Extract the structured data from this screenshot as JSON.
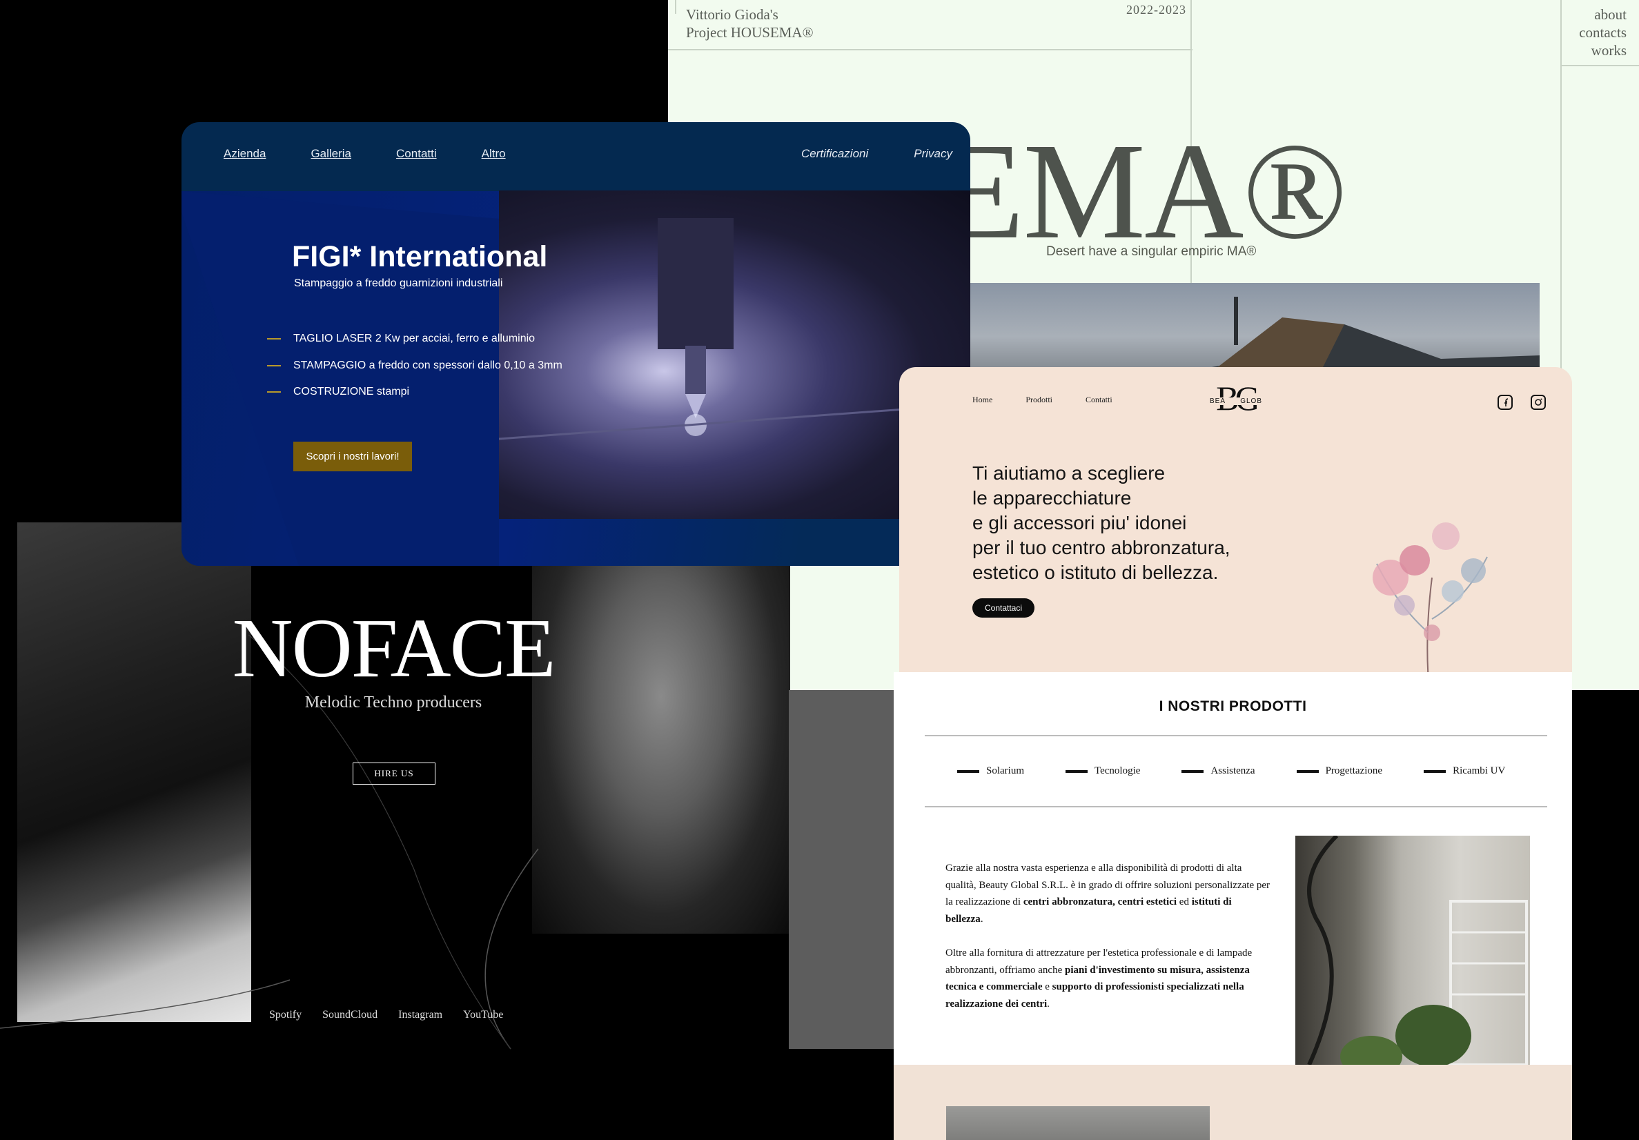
{
  "housema": {
    "author_line1": "Vittorio Gioda's",
    "author_line2": "Project HOUSEMA®",
    "year": "2022-2023",
    "nav": [
      "about",
      "contacts",
      "works"
    ],
    "big_title": "OUSEMA®",
    "tagline": "Desert have a singular empiric MA®"
  },
  "figi": {
    "nav_left": [
      "Azienda",
      "Galleria",
      "Contatti",
      "Altro"
    ],
    "nav_right": [
      "Certificazioni",
      "Privacy"
    ],
    "title": "FIGI* International",
    "subtitle": "Stampaggio a freddo guarnizioni industriali",
    "features": [
      "TAGLIO LASER 2 Kw per acciai, ferro e alluminio",
      "STAMPAGGIO a freddo con spessori dallo 0,10 a 3mm",
      "COSTRUZIONE stampi"
    ],
    "cta": "Scopri i nostri lavori!",
    "accent": "#7a5d0a"
  },
  "noface": {
    "title": "NOFACE",
    "subtitle": "Melodic Techno producers",
    "cta": "HIRE US",
    "links": [
      "Spotify",
      "SoundCloud",
      "Instagram",
      "YouTube"
    ]
  },
  "beauty": {
    "nav": [
      "Home",
      "Prodotti",
      "Contatti"
    ],
    "logo_mark": "BG",
    "logo_left": "BEA",
    "logo_right": "GLOB",
    "headline": [
      "Ti aiutiamo a scegliere",
      "le apparecchiature",
      "e gli accessori piu' idonei",
      "per il tuo centro abbronzatura,",
      "estetico o istituto di bellezza."
    ],
    "cta": "Contattaci",
    "section_title": "I NOSTRI PRODOTTI",
    "categories": [
      "Solarium",
      "Tecnologie",
      "Assistenza",
      "Progettazione",
      "Ricambi UV"
    ],
    "p1_parts": [
      "Grazie alla nostra vasta esperienza e alla disponibilità di prodotti di alta qualità, Beauty Global S.R.L. è in grado di offrire soluzioni personalizzate per la realizzazione di ",
      "centri abbronzatura, centri estetici",
      " ed ",
      "istituti di bellezza",
      "."
    ],
    "p2_parts": [
      "Oltre alla fornitura di attrezzature per l'estetica professionale e di lampade abbronzanti, offriamo anche ",
      "piani d'investimento su misura, assistenza tecnica e commerciale",
      " e ",
      "supporto di professionisti specializzati nella realizzazione dei centri",
      "."
    ],
    "social_icons": [
      "facebook-icon",
      "instagram-icon"
    ]
  }
}
